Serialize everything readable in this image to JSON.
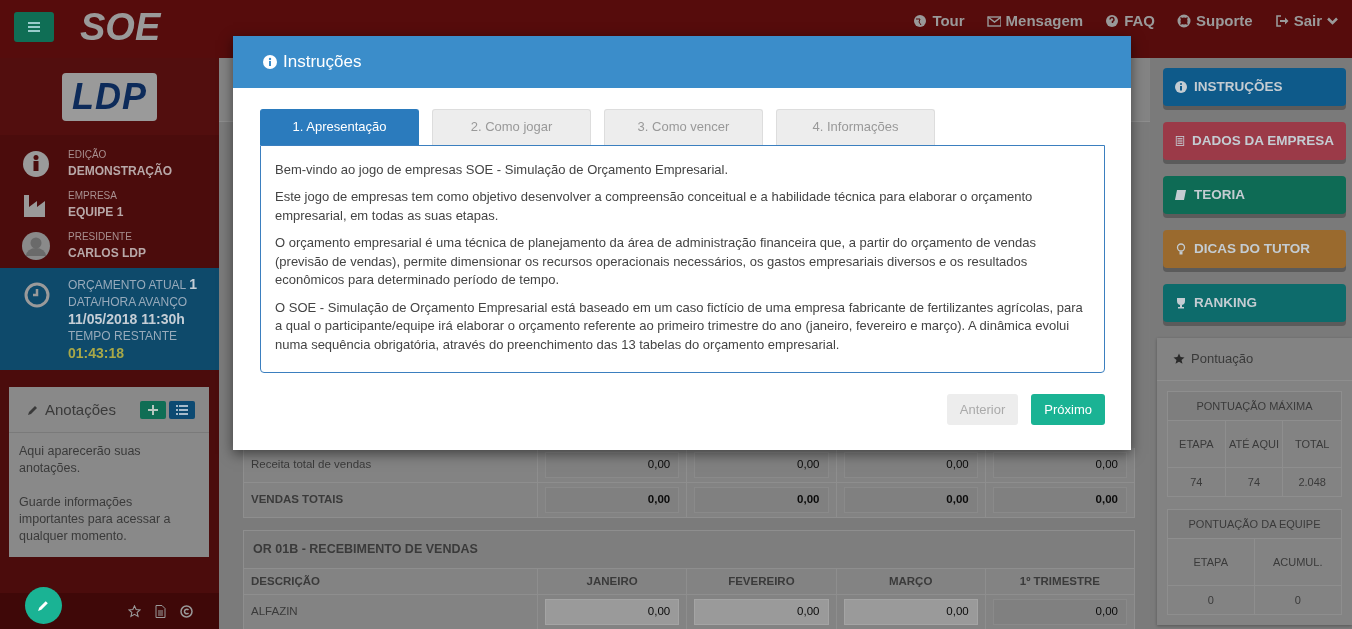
{
  "navbar": {
    "brand": "SOE",
    "links": [
      {
        "label": "Tour"
      },
      {
        "label": "Mensagem"
      },
      {
        "label": "FAQ"
      },
      {
        "label": "Suporte"
      },
      {
        "label": "Sair"
      }
    ]
  },
  "sidebar": {
    "logo": "LDP",
    "profile": [
      {
        "label": "EDIÇÃO",
        "value": "DEMONSTRAÇÃO"
      },
      {
        "label": "EMPRESA",
        "value": "EQUIPE 1"
      },
      {
        "label": "PRESIDENTE",
        "value": "CARLOS LDP"
      }
    ],
    "budget": {
      "title": "ORÇAMENTO ATUAL",
      "number": "1",
      "advance_label": "DATA/HORA AVANÇO",
      "advance": "11/05/2018 11:30h",
      "remaining_label": "TEMPO RESTANTE",
      "remaining": "01:43:18"
    },
    "notes": {
      "title": "Anotações",
      "paragraphs": [
        "Aqui aparecerão suas anotações.",
        "Guarde informações importantes para acessar a qualquer momento."
      ]
    }
  },
  "main": {
    "sales_rows": [
      {
        "label": "Receita total de vendas",
        "bold": false,
        "cells": [
          {
            "value": "0,00",
            "readonly": true
          },
          {
            "value": "0,00",
            "readonly": true
          },
          {
            "value": "0,00",
            "readonly": true
          },
          {
            "value": "0,00",
            "readonly": true
          }
        ]
      },
      {
        "label": "VENDAS TOTAIS",
        "bold": true,
        "cells": [
          {
            "value": "0,00",
            "readonly": true
          },
          {
            "value": "0,00",
            "readonly": true
          },
          {
            "value": "0,00",
            "readonly": true
          },
          {
            "value": "0,00",
            "readonly": true
          }
        ]
      }
    ],
    "receipts": {
      "title": "OR 01B - RECEBIMENTO DE VENDAS",
      "columns": [
        "DESCRIÇÃO",
        "JANEIRO",
        "FEVEREIRO",
        "MARÇO",
        "1º TRIMESTRE"
      ],
      "rows": [
        {
          "label": "ALFAZIN",
          "bold": false,
          "cells": [
            {
              "value": "0,00",
              "readonly": false
            },
            {
              "value": "0,00",
              "readonly": false
            },
            {
              "value": "0,00",
              "readonly": false
            },
            {
              "value": "0,00",
              "readonly": true
            }
          ]
        }
      ]
    }
  },
  "right_menu": [
    {
      "label": "INSTRUÇÕES",
      "color": "#0e5a8a"
    },
    {
      "label": "DADOS DA EMPRESA",
      "color": "#9b3a48"
    },
    {
      "label": "TEORIA",
      "color": "#0e6b55"
    },
    {
      "label": "DICAS DO TUTOR",
      "color": "#9a6a2e"
    },
    {
      "label": "RANKING",
      "color": "#0d6b6b"
    }
  ],
  "score": {
    "title": "Pontuação",
    "max": {
      "title": "PONTUAÇÃO MÁXIMA",
      "columns": [
        "ETAPA",
        "ATÉ AQUI",
        "TOTAL"
      ],
      "values": [
        "74",
        "74",
        "2.048"
      ]
    },
    "team": {
      "title": "PONTUAÇÃO DA EQUIPE",
      "columns": [
        "ETAPA",
        "ACUMUL."
      ],
      "values": [
        "0",
        "0"
      ]
    }
  },
  "modal": {
    "title": "Instruções",
    "tabs": [
      {
        "label": "1. Apresentação",
        "selected": true
      },
      {
        "label": "2. Como jogar",
        "selected": false
      },
      {
        "label": "3. Como vencer",
        "selected": false
      },
      {
        "label": "4. Informações",
        "selected": false
      }
    ],
    "paragraphs": [
      "Bem-vindo ao jogo de empresas SOE - Simulação de Orçamento Empresarial.",
      "Este jogo de empresas tem como objetivo desenvolver a compreensão conceitual e a habilidade técnica para elaborar o orçamento empresarial, em todas as suas etapas.",
      "O orçamento empresarial é uma técnica de planejamento da área de administração financeira que, a partir do orçamento de vendas (previsão de vendas), permite dimensionar os recursos operacionais necessários, os gastos empresariais diversos e os resultados econômicos para determinado período de tempo.",
      "O SOE - Simulação de Orçamento Empresarial está baseado em um caso fictício de uma empresa fabricante de fertilizantes agrícolas, para a qual o participante/equipe irá elaborar o orçamento referente ao primeiro trimestre do ano (janeiro, fevereiro e março). A dinâmica evolui numa sequência obrigatória, através do preenchimento das 13 tabelas do orçamento empresarial."
    ],
    "buttons": [
      {
        "label": "Anterior",
        "disabled": true
      },
      {
        "label": "Próximo",
        "disabled": false
      }
    ]
  }
}
